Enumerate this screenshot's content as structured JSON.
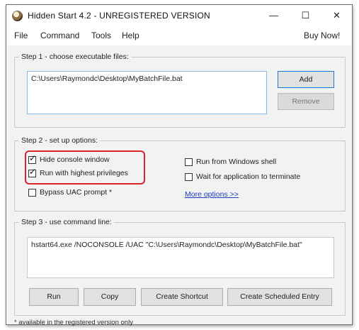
{
  "window": {
    "title": "Hidden Start 4.2 - UNREGISTERED VERSION",
    "minimize_glyph": "—",
    "maximize_glyph": "☐",
    "close_glyph": "✕"
  },
  "menu": {
    "items": [
      "File",
      "Command",
      "Tools",
      "Help"
    ],
    "buy_now": "Buy Now!"
  },
  "step1": {
    "legend": "Step 1 - choose executable files:",
    "file_path": "C:\\Users\\Raymondc\\Desktop\\MyBatchFile.bat",
    "add_label": "Add",
    "remove_label": "Remove"
  },
  "step2": {
    "legend": "Step 2 - set up options:",
    "options": [
      {
        "label": "Hide console window",
        "checked": true
      },
      {
        "label": "Run with highest privileges",
        "checked": true
      },
      {
        "label": "Bypass UAC prompt *",
        "checked": false
      },
      {
        "label": "Run from Windows shell",
        "checked": false
      },
      {
        "label": "Wait for application to terminate",
        "checked": false
      }
    ],
    "more_options": "More options >>",
    "check_glyph": "✓",
    "highlight_color": "#d9252a"
  },
  "step3": {
    "legend": "Step 3 - use command line:",
    "command": "hstart64.exe /NOCONSOLE /UAC \"C:\\Users\\Raymondc\\Desktop\\MyBatchFile.bat\"",
    "buttons": [
      "Run",
      "Copy",
      "Create Shortcut",
      "Create Scheduled Entry"
    ]
  },
  "footnote": "* available in the registered version only"
}
